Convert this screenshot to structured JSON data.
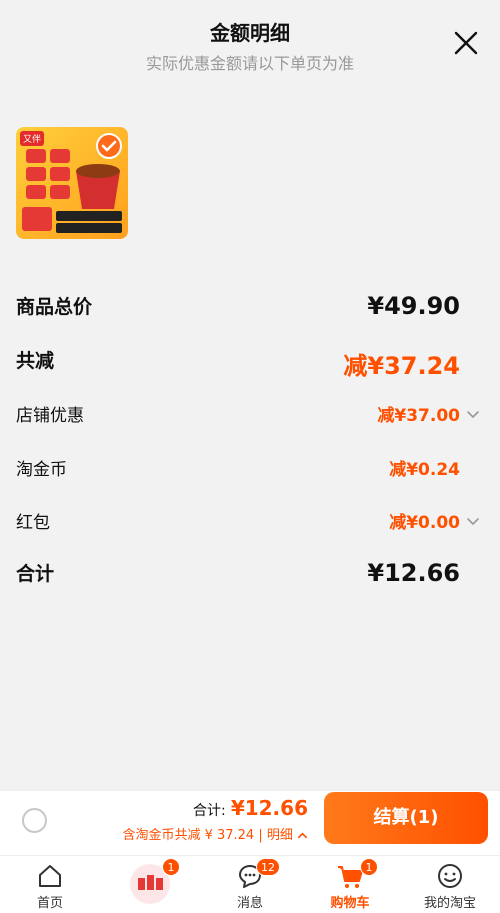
{
  "header": {
    "title": "金额明细",
    "subtitle": "实际优惠金额请以下单页为准"
  },
  "product": {
    "badge": "又伴"
  },
  "summary": {
    "goods_total_label": "商品总价",
    "goods_total_value": "¥49.90",
    "total_discount_label": "共减",
    "total_discount_value": "减¥37.24",
    "shop_discount_label": "店铺优惠",
    "shop_discount_value": "减¥37.00",
    "coin_label": "淘金币",
    "coin_value": "减¥0.24",
    "redpacket_label": "红包",
    "redpacket_value": "减¥0.00",
    "subtotal_label": "合计",
    "subtotal_value": "¥12.66"
  },
  "bottom_bar": {
    "total_label": "合计:",
    "total_amount": "¥12.66",
    "detail_text": "含淘金币共减 ¥ 37.24 | 明细",
    "checkout_label": "结算(1)"
  },
  "tabs": [
    {
      "label": "首页",
      "icon": "home-icon"
    },
    {
      "label": "",
      "icon": "promo-icon",
      "badge": "1"
    },
    {
      "label": "消息",
      "icon": "message-icon",
      "badge": "12"
    },
    {
      "label": "购物车",
      "icon": "cart-icon",
      "badge": "1"
    },
    {
      "label": "我的淘宝",
      "icon": "profile-icon"
    }
  ],
  "colors": {
    "accent": "#ff5000",
    "background": "#f2f2f2"
  }
}
